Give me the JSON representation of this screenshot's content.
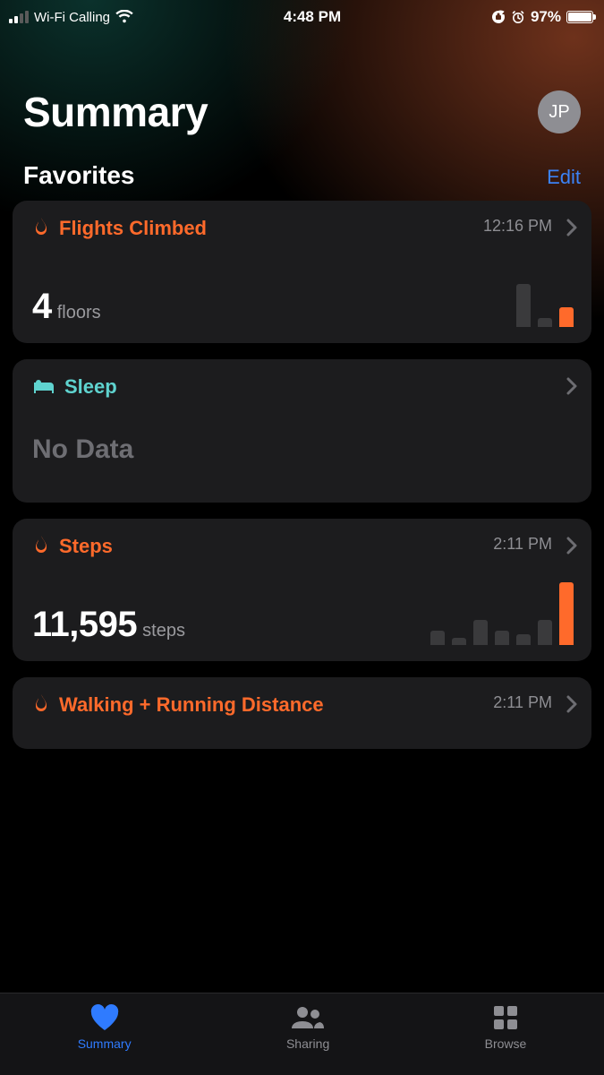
{
  "status": {
    "carrier": "Wi-Fi Calling",
    "time": "4:48 PM",
    "battery_pct": "97%"
  },
  "header": {
    "title": "Summary",
    "avatar_initials": "JP"
  },
  "favorites": {
    "section_title": "Favorites",
    "edit_label": "Edit"
  },
  "cards": {
    "flights": {
      "title": "Flights Climbed",
      "time": "12:16 PM",
      "value": "4",
      "unit": "floors",
      "bars": [
        0,
        0,
        0,
        0,
        48,
        10,
        22
      ],
      "highlight_index": 6
    },
    "sleep": {
      "title": "Sleep",
      "no_data": "No Data"
    },
    "steps": {
      "title": "Steps",
      "time": "2:11 PM",
      "value": "11,595",
      "unit": "steps",
      "bars": [
        16,
        8,
        28,
        16,
        12,
        28,
        70
      ],
      "highlight_index": 6
    },
    "walk": {
      "title": "Walking + Running Distance",
      "time": "2:11 PM"
    }
  },
  "tabs": {
    "summary": "Summary",
    "sharing": "Sharing",
    "browse": "Browse"
  }
}
